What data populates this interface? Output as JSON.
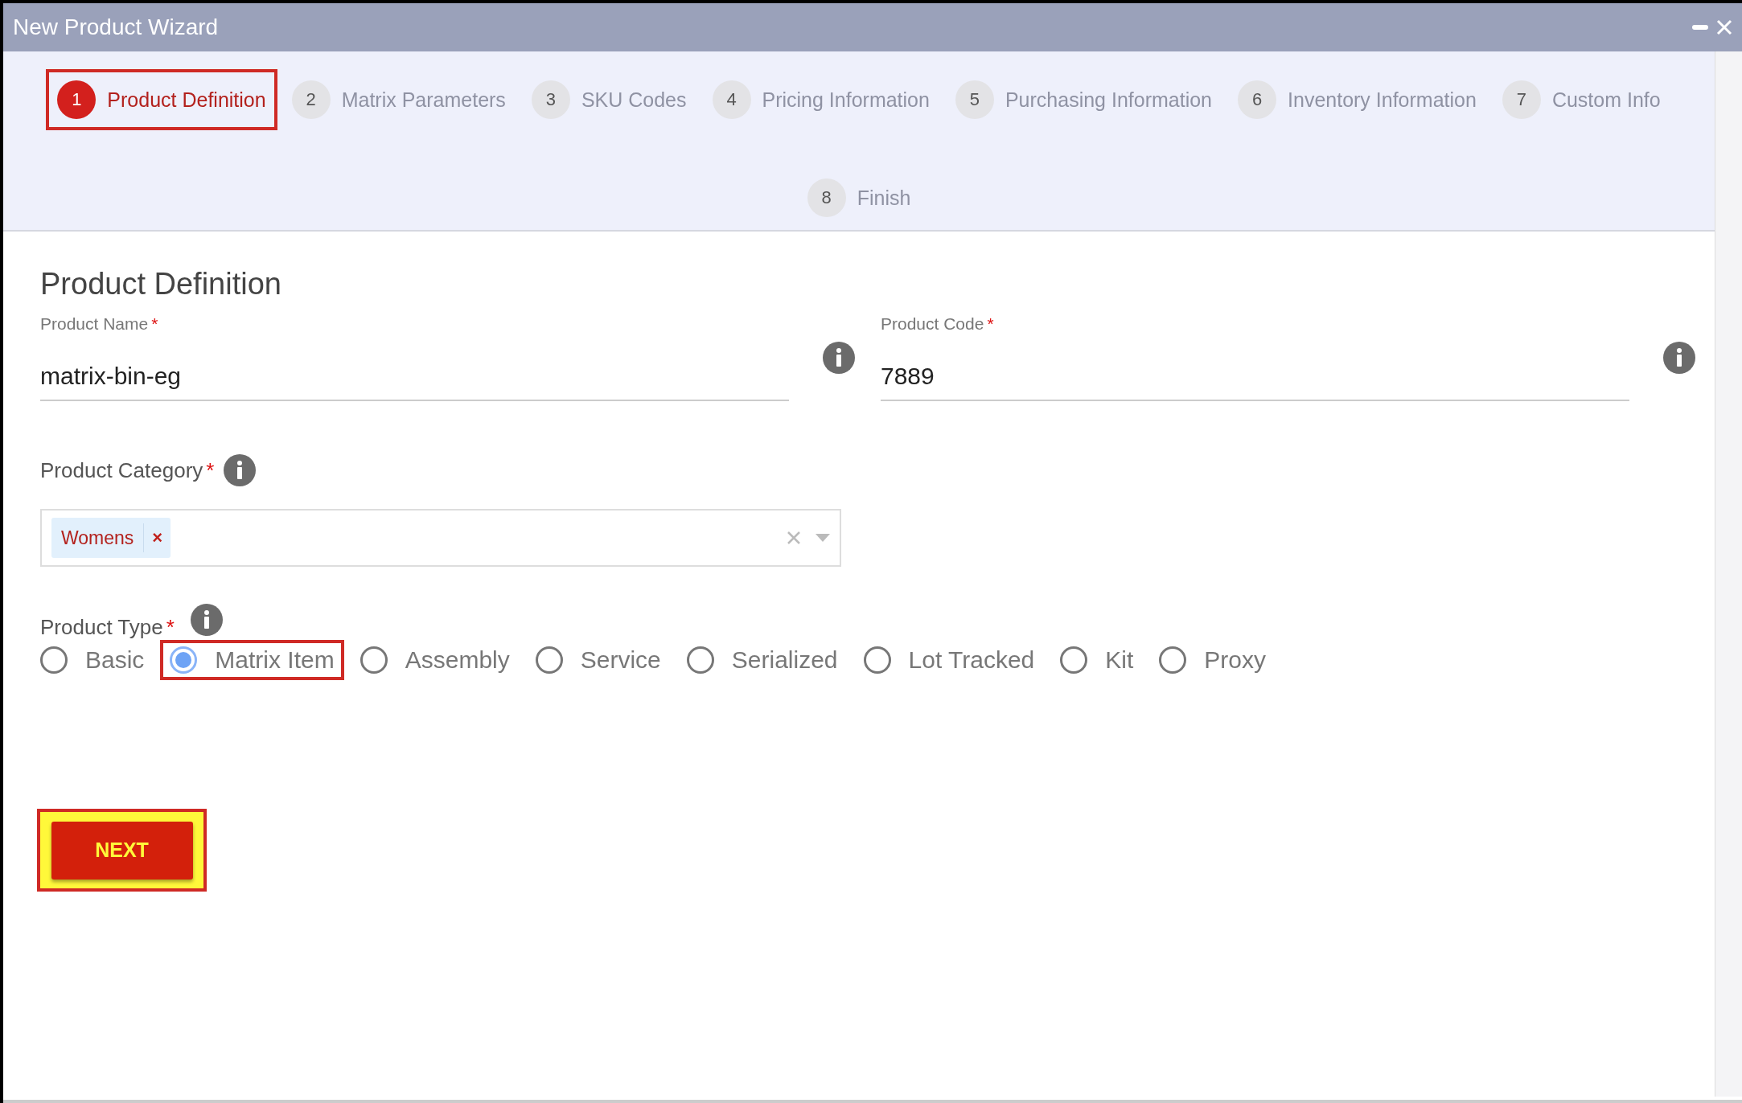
{
  "window": {
    "title": "New Product Wizard"
  },
  "steps": [
    {
      "number": "1",
      "label": "Product Definition",
      "selected": true,
      "highlighted": true
    },
    {
      "number": "2",
      "label": "Matrix Parameters",
      "selected": false,
      "highlighted": false
    },
    {
      "number": "3",
      "label": "SKU Codes",
      "selected": false,
      "highlighted": false
    },
    {
      "number": "4",
      "label": "Pricing Information",
      "selected": false,
      "highlighted": false
    },
    {
      "number": "5",
      "label": "Purchasing Information",
      "selected": false,
      "highlighted": false
    },
    {
      "number": "6",
      "label": "Inventory Information",
      "selected": false,
      "highlighted": false
    },
    {
      "number": "7",
      "label": "Custom Info",
      "selected": false,
      "highlighted": false
    },
    {
      "number": "8",
      "label": "Finish",
      "selected": false,
      "highlighted": false
    }
  ],
  "section_title": "Product Definition",
  "fields": [
    {
      "label": "Product Name",
      "required_mark": "*",
      "value": "matrix-bin-eg"
    },
    {
      "label": "Product Code",
      "required_mark": "*",
      "value": "7889"
    }
  ],
  "category": {
    "label": "Product Category",
    "required_mark": "*",
    "tags": [
      {
        "text": "Womens",
        "remove": "×"
      }
    ]
  },
  "product_type": {
    "label": "Product Type",
    "required_mark": "*",
    "options": [
      {
        "label": "Basic",
        "selected": false,
        "highlighted": false
      },
      {
        "label": "Matrix Item",
        "selected": true,
        "highlighted": true
      },
      {
        "label": "Assembly",
        "selected": false,
        "highlighted": false
      },
      {
        "label": "Service",
        "selected": false,
        "highlighted": false
      },
      {
        "label": "Serialized",
        "selected": false,
        "highlighted": false
      },
      {
        "label": "Lot Tracked",
        "selected": false,
        "highlighted": false
      },
      {
        "label": "Kit",
        "selected": false,
        "highlighted": false
      },
      {
        "label": "Proxy",
        "selected": false,
        "highlighted": false
      }
    ]
  },
  "next_button": {
    "label": "NEXT",
    "highlighted": true
  }
}
